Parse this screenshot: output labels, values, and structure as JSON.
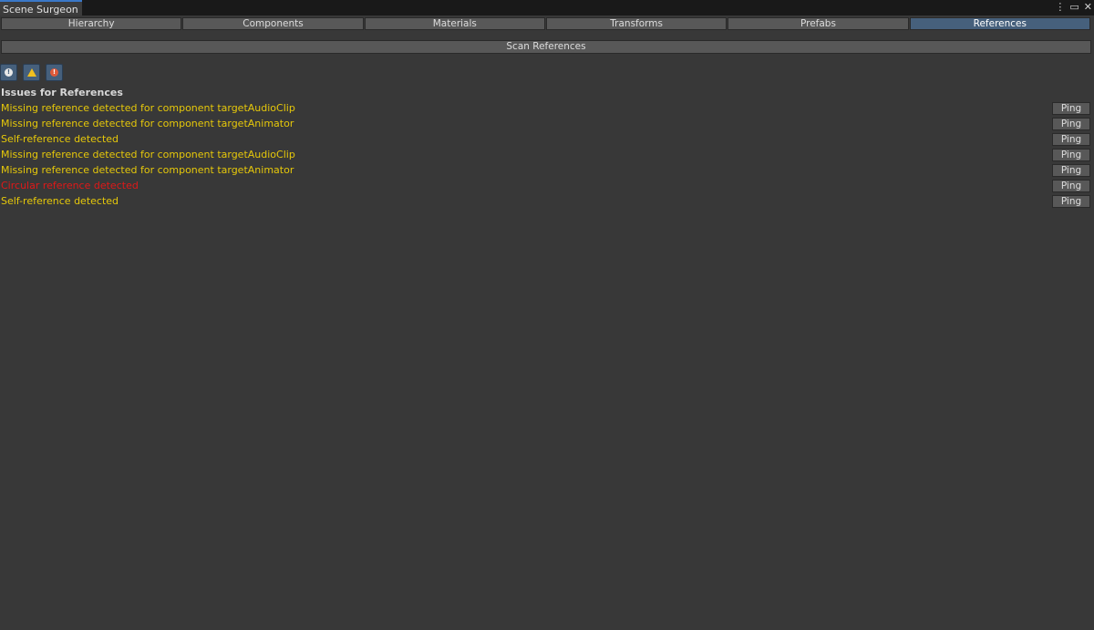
{
  "window": {
    "title": "Scene Surgeon",
    "icons": [
      "kebab-menu-icon",
      "maximize-icon",
      "close-icon"
    ]
  },
  "tabs": [
    {
      "label": "Hierarchy",
      "active": false
    },
    {
      "label": "Components",
      "active": false
    },
    {
      "label": "Materials",
      "active": false
    },
    {
      "label": "Transforms",
      "active": false
    },
    {
      "label": "Prefabs",
      "active": false
    },
    {
      "label": "References",
      "active": true
    }
  ],
  "scan_button": "Scan References",
  "filters": [
    {
      "name": "info-filter",
      "icon": "info-icon"
    },
    {
      "name": "warning-filter",
      "icon": "warning-icon"
    },
    {
      "name": "error-filter",
      "icon": "error-icon"
    }
  ],
  "section_title": "Issues for References",
  "issues": [
    {
      "message": "Missing reference detected for component targetAudioClip",
      "severity": "warning",
      "action": "Ping"
    },
    {
      "message": "Missing reference detected for component targetAnimator",
      "severity": "warning",
      "action": "Ping"
    },
    {
      "message": "Self-reference detected",
      "severity": "warning",
      "action": "Ping"
    },
    {
      "message": "Missing reference detected for component targetAudioClip",
      "severity": "warning",
      "action": "Ping"
    },
    {
      "message": "Missing reference detected for component targetAnimator",
      "severity": "warning",
      "action": "Ping"
    },
    {
      "message": "Circular reference detected",
      "severity": "error",
      "action": "Ping"
    },
    {
      "message": "Self-reference detected",
      "severity": "warning",
      "action": "Ping"
    }
  ],
  "colors": {
    "accent": "#46607c",
    "warning": "#e6c80a",
    "error": "#e01818",
    "background": "#383838"
  }
}
